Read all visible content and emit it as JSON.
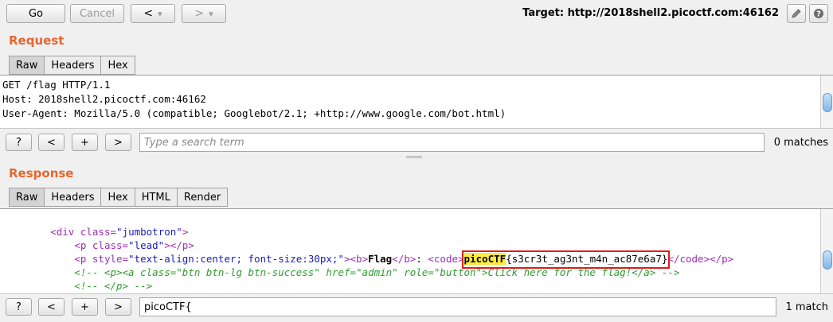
{
  "toolbar": {
    "go_label": "Go",
    "cancel_label": "Cancel",
    "back_label": "<",
    "forward_label": ">",
    "dropdown_glyph": "▾",
    "target_text": "Target: http://2018shell2.picoctf.com:46162",
    "edit_icon": "pencil-icon",
    "help_icon": "help-icon"
  },
  "request": {
    "title": "Request",
    "tabs": [
      "Raw",
      "Headers",
      "Hex"
    ],
    "active_tab": "Raw",
    "lines": [
      "GET /flag HTTP/1.1",
      "Host: 2018shell2.picoctf.com:46162",
      "User-Agent: Mozilla/5.0 (compatible; Googlebot/2.1; +http://www.google.com/bot.html)"
    ],
    "search": {
      "help_label": "?",
      "prev_label": "<",
      "add_label": "+",
      "next_label": ">",
      "placeholder": "Type a search term",
      "value": "",
      "matches": "0 matches"
    }
  },
  "response": {
    "title": "Response",
    "tabs": [
      "Raw",
      "Headers",
      "Hex",
      "HTML",
      "Render"
    ],
    "active_tab": "Raw",
    "code": {
      "line1": {
        "indent": "        ",
        "open": "<div ",
        "attr": "class=",
        "val": "\"jumbotron\"",
        "close": ">"
      },
      "line2": {
        "indent": "            ",
        "open": "<p ",
        "attr": "class=",
        "val": "\"lead\"",
        "close": "></p>"
      },
      "line3": {
        "indent": "            ",
        "p_open": "<p ",
        "attr": "style=",
        "val": "\"text-align:center; font-size:30px;\"",
        "close": ">",
        "b_open": "<b>",
        "b_text": "Flag",
        "b_close": "</b>",
        "colon": ": ",
        "code_open": "<code>",
        "flag_hl": "picoCTF",
        "flag_rest": "{s3cr3t_ag3nt_m4n_ac87e6a7}",
        "code_close": "</code>",
        "p_close": "</p>"
      },
      "line4": "            <!-- <p><a class=\"btn btn-lg btn-success\" href=\"admin\" role=\"button\">Click here for the flag!</a> -->",
      "line5": "            <!-- </p> -->"
    },
    "search": {
      "help_label": "?",
      "prev_label": "<",
      "add_label": "+",
      "next_label": ">",
      "placeholder": "",
      "value": "picoCTF{",
      "matches": "1 match"
    }
  },
  "colors": {
    "section_title": "#e8662e",
    "highlight": "#ffeb3b",
    "flag_border": "#e01b1b"
  }
}
